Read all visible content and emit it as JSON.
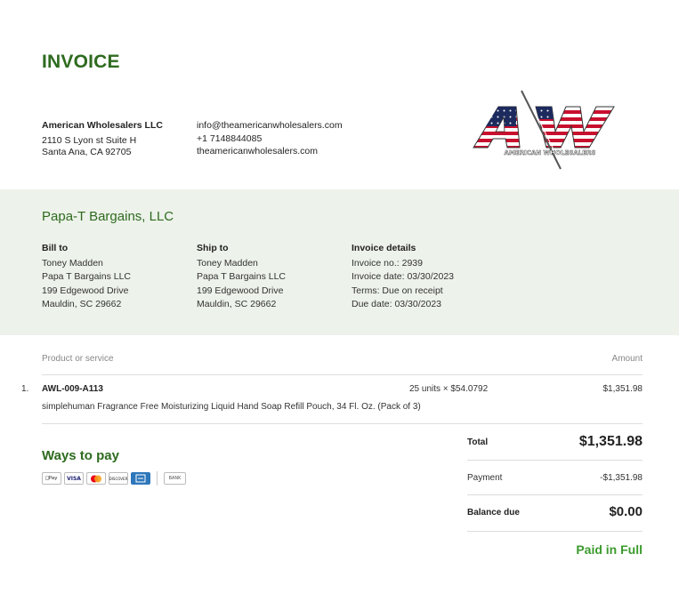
{
  "title": "INVOICE",
  "company": {
    "name": "American Wholesalers LLC",
    "address1": "2110 S Lyon st Suite H",
    "address2": "Santa Ana, CA 92705",
    "email": "info@theamericanwholesalers.com",
    "phone": "+1 7148844085",
    "website": "theamericanwholesalers.com",
    "logo_text": "AMERICAN WHOLESALERS"
  },
  "customer": {
    "name": "Papa-T Bargains, LLC",
    "bill_to": {
      "heading": "Bill to",
      "line1": "Toney Madden",
      "line2": "Papa T Bargains LLC",
      "line3": "199 Edgewood Drive",
      "line4": "Mauldin, SC 29662"
    },
    "ship_to": {
      "heading": "Ship to",
      "line1": "Toney Madden",
      "line2": "Papa T Bargains LLC",
      "line3": "199 Edgewood Drive",
      "line4": "Mauldin, SC 29662"
    },
    "details": {
      "heading": "Invoice details",
      "invoice_no": "Invoice no.: 2939",
      "invoice_date": "Invoice date: 03/30/2023",
      "terms": "Terms: Due on receipt",
      "due_date": "Due date: 03/30/2023"
    }
  },
  "table": {
    "col_product": "Product or service",
    "col_amount": "Amount",
    "items": [
      {
        "num": "1.",
        "sku": "AWL-009-A113",
        "qty": "25 units × $54.0792",
        "amount": "$1,351.98",
        "description": "simplehuman Fragrance Free Moisturizing Liquid Hand Soap Refill Pouch, 34 Fl. Oz. (Pack of 3)"
      }
    ]
  },
  "ways_to_pay": {
    "heading": "Ways to pay",
    "methods": {
      "applepay": "Pay",
      "visa": "VISA",
      "discover": "DISCOVER",
      "bank": "BANK"
    }
  },
  "summary": {
    "total_label": "Total",
    "total_value": "$1,351.98",
    "payment_label": "Payment",
    "payment_value": "-$1,351.98",
    "balance_label": "Balance due",
    "balance_value": "$0.00",
    "status": "Paid in Full"
  }
}
